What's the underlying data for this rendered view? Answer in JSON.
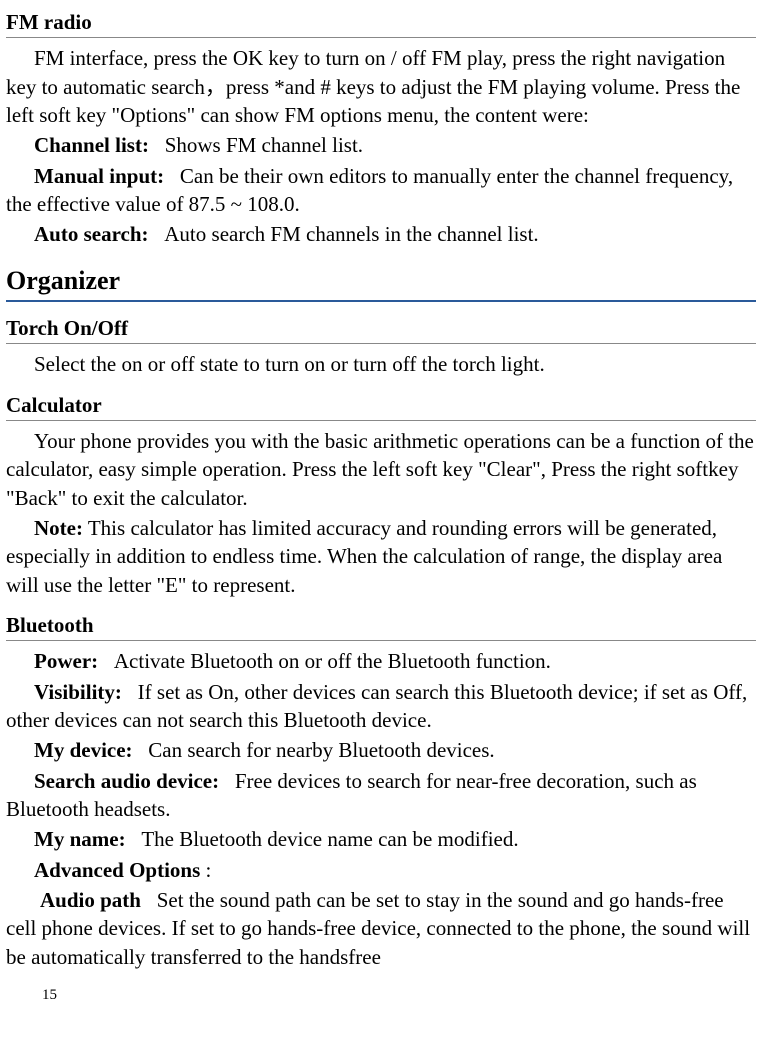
{
  "fm_radio": {
    "heading": "FM radio",
    "intro": "FM interface, press the OK key to turn on / off FM play, press the right navigation key to automatic search，press *and # keys to adjust the FM playing volume. Press the left soft key \"Options\" can show FM options menu, the content were:",
    "items": [
      {
        "label": "Channel list:",
        "desc": "Shows FM channel list."
      },
      {
        "label": "Manual input:",
        "desc": "Can be their own editors to manually enter the channel frequency, the effective value of 87.5 ~ 108.0."
      },
      {
        "label": "Auto search:",
        "desc": "Auto search FM channels in the channel list."
      }
    ]
  },
  "organizer": {
    "heading": "Organizer",
    "torch": {
      "heading": "Torch On/Off",
      "desc": "Select the on or off state to turn on or turn off the torch light."
    },
    "calculator": {
      "heading": "Calculator",
      "desc": "Your phone provides you with the basic arithmetic operations can be a function of the calculator, easy simple operation. Press the left soft key \"Clear\", Press the right softkey \"Back\" to exit the calculator.",
      "note_label": "Note:",
      "note_desc": " This calculator has limited accuracy and rounding errors will be generated, especially in addition to endless time. When the calculation of range, the display area will use the letter \"E\" to represent."
    },
    "bluetooth": {
      "heading": "Bluetooth",
      "items": [
        {
          "label": "Power:",
          "desc": "Activate Bluetooth on or off the Bluetooth function."
        },
        {
          "label": "Visibility:",
          "desc": "If set as On, other devices can search this Bluetooth device; if set as Off, other devices can not search this Bluetooth device."
        },
        {
          "label": "My device:",
          "desc": "Can search for nearby Bluetooth devices."
        },
        {
          "label": "Search audio device:",
          "desc": "Free devices to search for near-free decoration, such as Bluetooth headsets."
        },
        {
          "label": "My name:",
          "desc": "The Bluetooth device name can be modified."
        }
      ],
      "advanced_label": "Advanced Options",
      "advanced_colon": " :",
      "audio_path_label": "Audio path",
      "audio_path_desc": "Set the sound path can be set to stay in the sound and go hands-free cell phone devices. If set to go hands-free device, connected to the phone, the sound will be automatically transferred to the handsfree"
    }
  },
  "page_number": "15"
}
